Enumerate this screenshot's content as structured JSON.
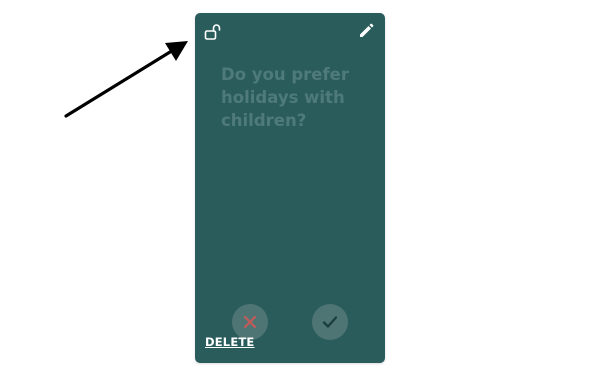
{
  "card": {
    "question": "Do you prefer holidays with children?",
    "delete_label": "DELETE",
    "lock_icon": "unlocked-padlock-icon",
    "edit_icon": "pencil-icon",
    "reject_icon": "x-icon",
    "accept_icon": "check-icon"
  },
  "colors": {
    "card_background": "#2b5c5c",
    "question_text": "#4e7a7a",
    "round_button": "#4e7474",
    "reject_mark": "#c35a5a",
    "accept_mark": "#1e3e3e",
    "arrow": "#000000"
  }
}
